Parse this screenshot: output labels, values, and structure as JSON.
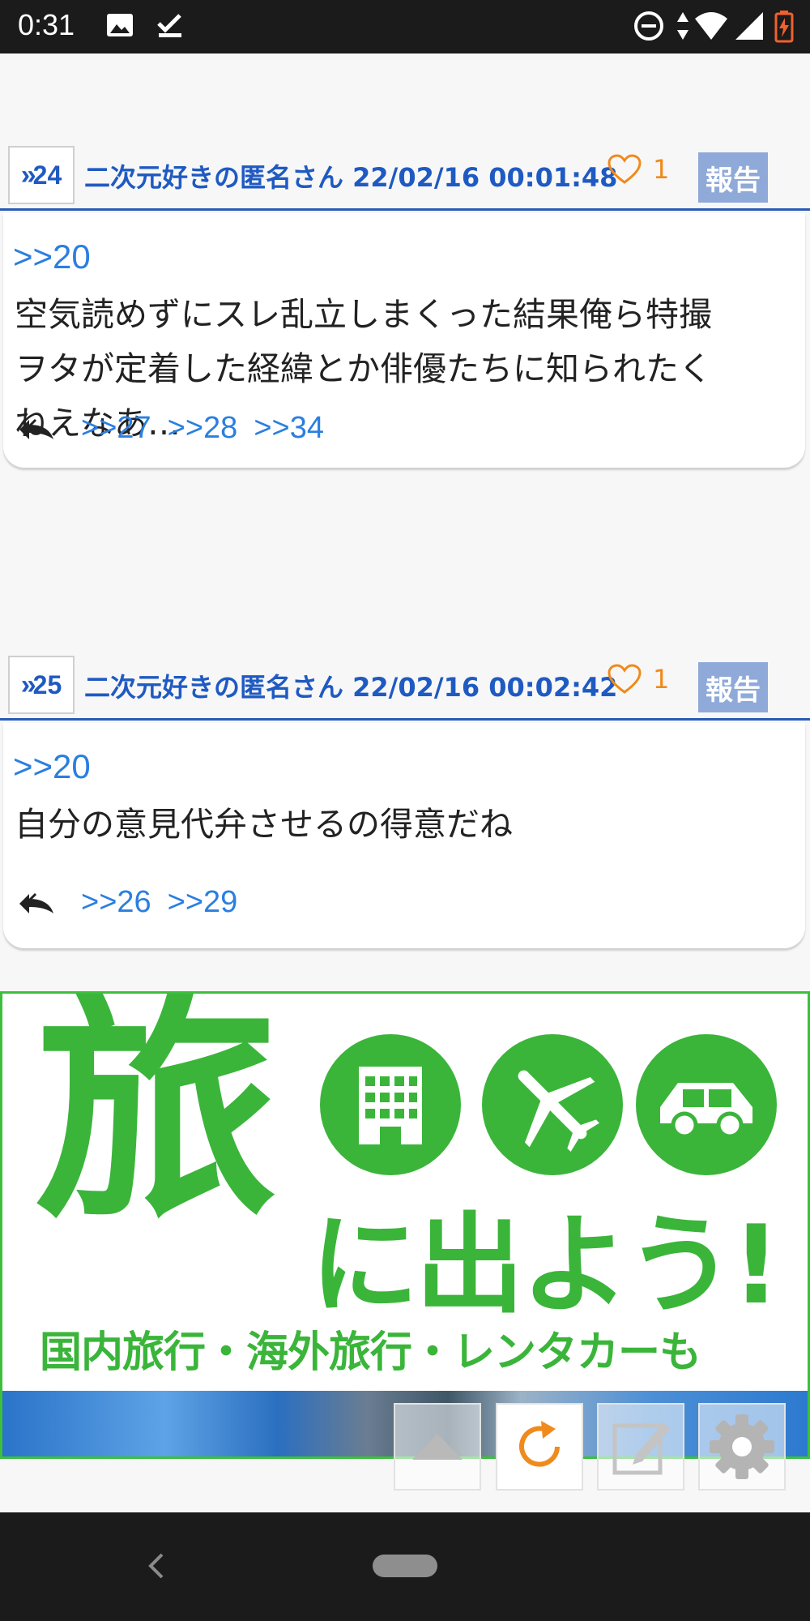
{
  "status_bar": {
    "time": "0:31",
    "icons": [
      "image-icon",
      "checkmark-icon",
      "do-not-disturb-icon",
      "data-arrows-icon",
      "wifi-icon",
      "cell-signal-icon",
      "battery-charging-icon"
    ]
  },
  "posts": [
    {
      "number": "24",
      "author_line": "二次元好きの匿名さん 22/02/16 00:01:48",
      "likes": "1",
      "report_label": "報告",
      "anchor": ">>20",
      "text_lines": [
        "空気読めずにスレ乱立しまくった結果俺ら特撮",
        "ヲタが定着した経緯とか俳優たちに知られたく",
        "ねえなあ…"
      ],
      "replies": [
        ">>27",
        ">>28",
        ">>34"
      ]
    },
    {
      "number": "25",
      "author_line": "二次元好きの匿名さん 22/02/16 00:02:42",
      "likes": "1",
      "report_label": "報告",
      "anchor": ">>20",
      "text_lines": [
        "自分の意見代弁させるの得意だね"
      ],
      "replies": [
        ">>26",
        ">>29"
      ]
    }
  ],
  "banner": {
    "big_char": "旅",
    "headline": "に出よう!",
    "subline": "国内旅行・海外旅行・レンタカーも",
    "icons": [
      "hotel-icon",
      "airplane-icon",
      "car-icon"
    ]
  },
  "toolbar": {
    "buttons": [
      "scroll-top-button",
      "refresh-button",
      "edit-button",
      "settings-button"
    ]
  },
  "colors": {
    "accent_blue": "#1f5ac2",
    "link_blue": "#2a7fe0",
    "like_orange": "#f08a1c",
    "report_bg": "#8fa9d9",
    "banner_green": "#3ab53a"
  }
}
